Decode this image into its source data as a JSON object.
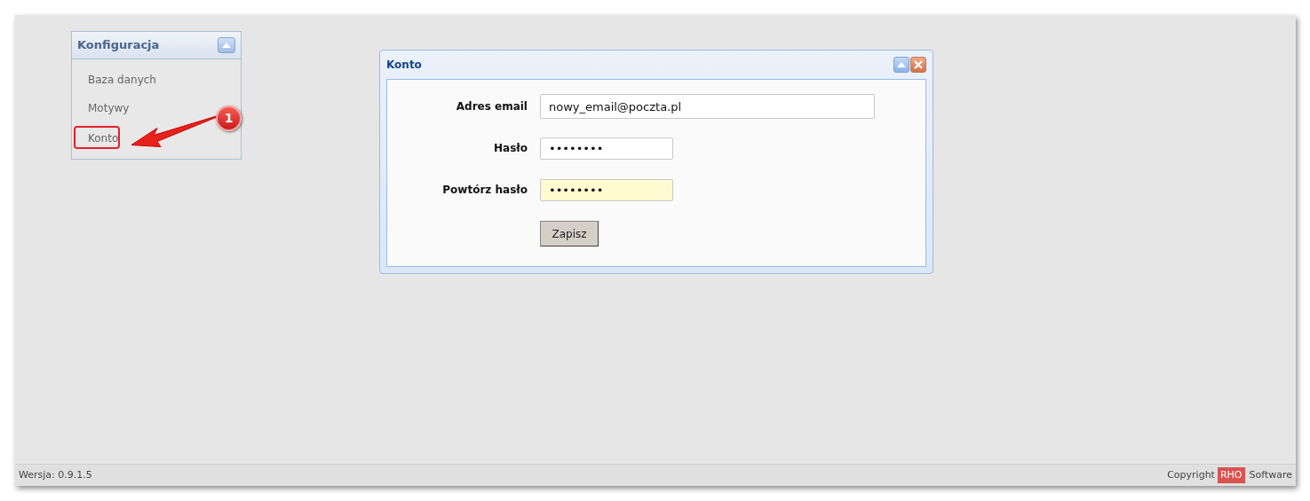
{
  "sidebar": {
    "title": "Konfiguracja",
    "items": [
      {
        "label": "Baza danych",
        "annotated": false
      },
      {
        "label": "Motywy",
        "annotated": false
      },
      {
        "label": "Konto",
        "annotated": true
      }
    ]
  },
  "callout": {
    "label": "1"
  },
  "dialog": {
    "title": "Konto",
    "fields": [
      {
        "label": "Adres email",
        "value": "nowy_email@poczta.pl",
        "kind": "wide",
        "focused": false
      },
      {
        "label": "Hasło",
        "value": "••••••••",
        "kind": "short",
        "focused": false
      },
      {
        "label": "Powtórz hasło",
        "value": "••••••••",
        "kind": "short",
        "focused": true
      }
    ],
    "button": "Zapisz"
  },
  "status_bar": {
    "version": "Wersja: 0.9.1.5",
    "copyright_prefix": "Copyright",
    "brand": "RHO",
    "copyright_suffix": "Software"
  }
}
